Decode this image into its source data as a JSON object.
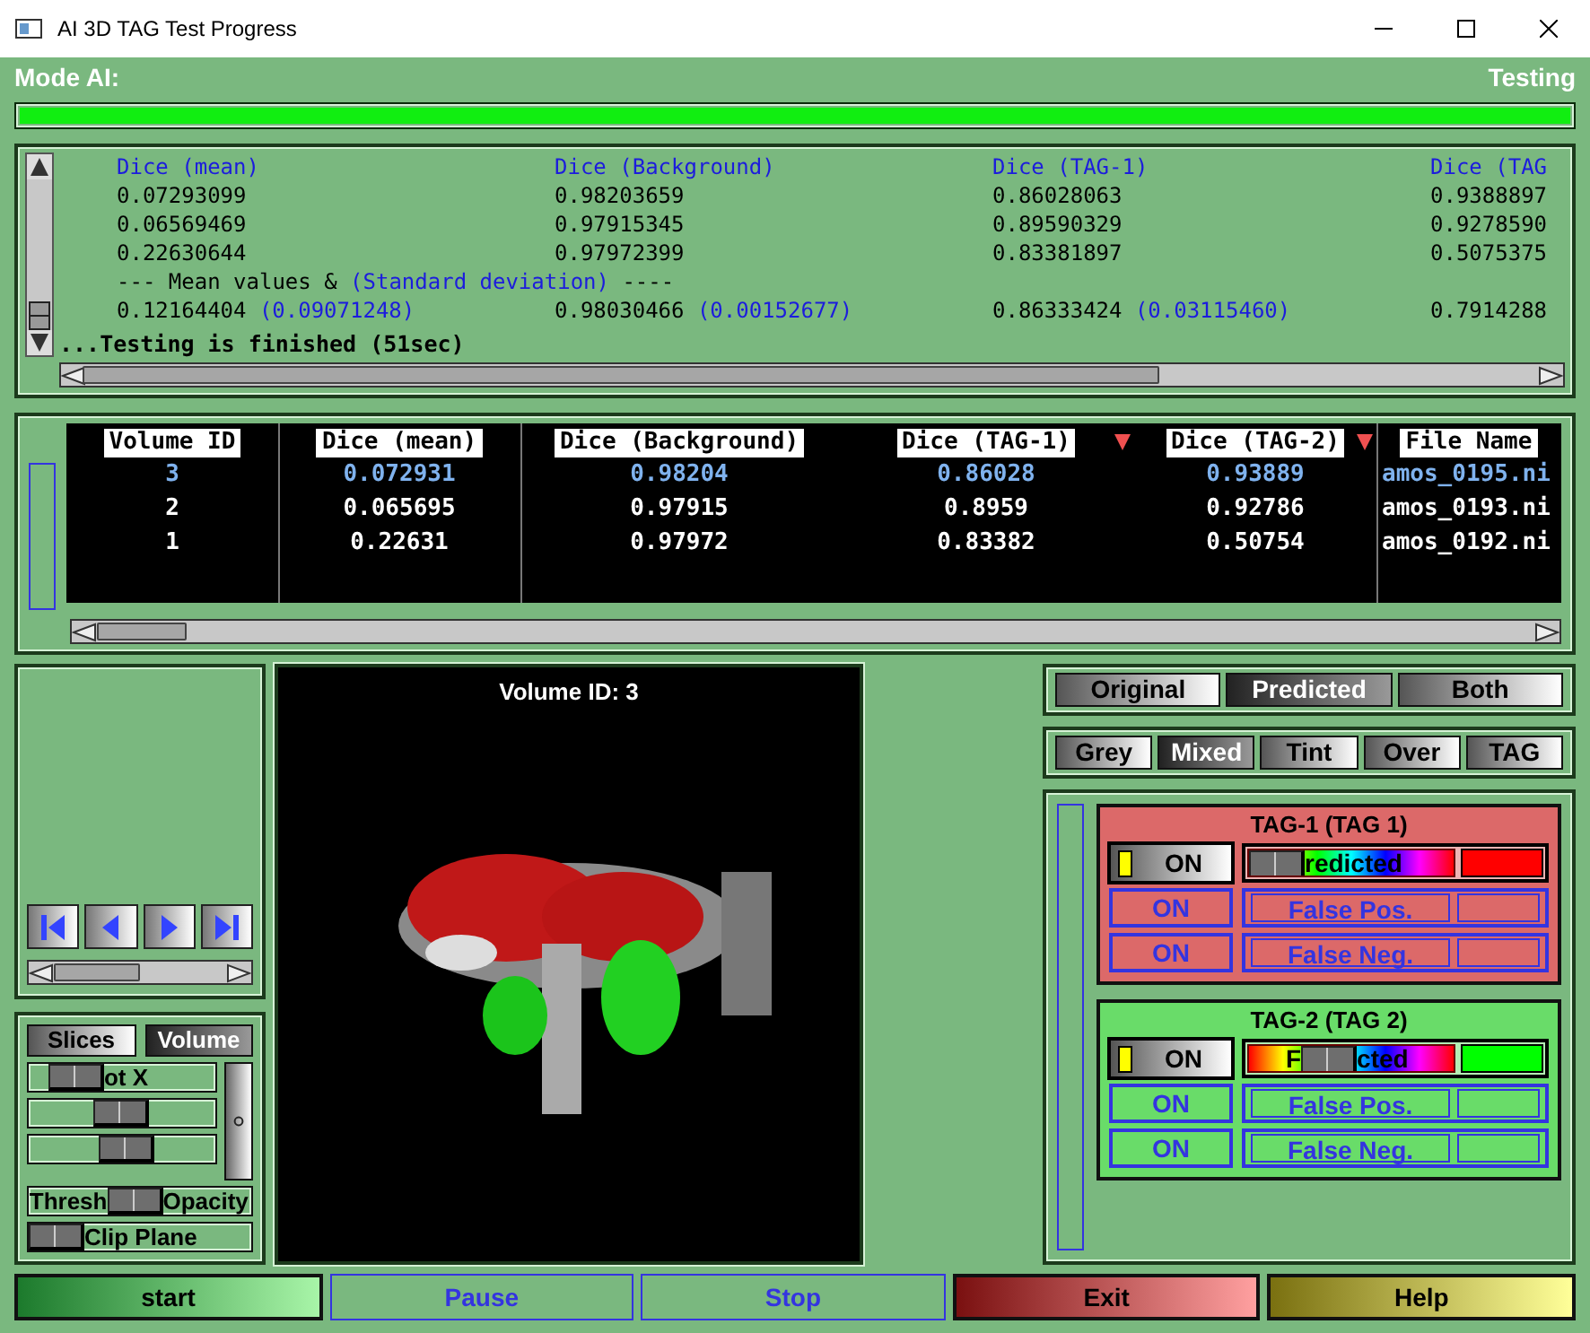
{
  "window": {
    "title": "AI 3D TAG Test Progress"
  },
  "header": {
    "mode": "Mode AI:",
    "status": "Testing"
  },
  "progress": {
    "level": 1
  },
  "log": {
    "columns": [
      "Dice (mean)",
      "Dice (Background)",
      "Dice (TAG-1)",
      "Dice (TAG"
    ],
    "rows": [
      [
        "0.07293099",
        "0.98203659",
        "0.86028063",
        "0.9388897"
      ],
      [
        "0.06569469",
        "0.97915345",
        "0.89590329",
        "0.9278590"
      ],
      [
        "0.22630644",
        "0.97972399",
        "0.83381897",
        "0.5075375"
      ]
    ],
    "summary": {
      "prefix": "--- Mean values &",
      "highlight": "(Standard deviation)",
      "suffix": "----"
    },
    "means": [
      {
        "value": "0.12164404",
        "std": "(0.09071248)"
      },
      {
        "value": "0.98030466",
        "std": "(0.00152677)"
      },
      {
        "value": "0.86333424",
        "std": "(0.03115460)"
      },
      {
        "value": "0.7914288"
      }
    ],
    "footer": "...Testing is finished (51sec)"
  },
  "table": {
    "columns": [
      {
        "label": "Volume ID"
      },
      {
        "label": "Dice (mean)"
      },
      {
        "label": "Dice (Background)"
      },
      {
        "label": "Dice (TAG-1)",
        "sorted": true
      },
      {
        "label": "Dice (TAG-2)",
        "sorted": true
      },
      {
        "label": "File Name"
      }
    ],
    "rows": [
      {
        "selected": true,
        "cells": [
          "3",
          "0.072931",
          "0.98204",
          "0.86028",
          "0.93889",
          "amos_0195.ni"
        ]
      },
      {
        "selected": false,
        "cells": [
          "2",
          "0.065695",
          "0.97915",
          "0.8959",
          "0.92786",
          "amos_0193.ni"
        ]
      },
      {
        "selected": false,
        "cells": [
          "1",
          "0.22631",
          "0.97972",
          "0.83382",
          "0.50754",
          "amos_0192.ni"
        ]
      }
    ]
  },
  "render_modes": [
    {
      "label": "Slices",
      "selected": false
    },
    {
      "label": "Volume",
      "selected": true
    }
  ],
  "sliders": [
    {
      "after": "ot X",
      "level": 0.15
    },
    {
      "level": 0.49
    },
    {
      "level": 0.54
    },
    {
      "before": "Thresh",
      "after": "Opacity",
      "level": 0.47
    },
    {
      "after": "Clip Plane",
      "level": 0
    }
  ],
  "vertical_slider": {
    "level": 0.5
  },
  "viewer": {
    "title": "Volume ID: 3"
  },
  "view_tabs": [
    {
      "label": "Original",
      "selected": false
    },
    {
      "label": "Predicted",
      "selected": true
    },
    {
      "label": "Both",
      "selected": false
    }
  ],
  "display_tabs": [
    {
      "label": "Grey",
      "selected": false
    },
    {
      "label": "Mixed",
      "selected": true
    },
    {
      "label": "Tint",
      "selected": false
    },
    {
      "label": "Over",
      "selected": false
    },
    {
      "label": "TAG",
      "selected": false
    }
  ],
  "tags": [
    {
      "title": "TAG-1 (TAG 1)",
      "color": "#ff0000",
      "toggle": {
        "label": "ON",
        "on": true
      },
      "slider": {
        "after": "redicted",
        "level": 0
      },
      "rows": [
        {
          "toggle": "ON",
          "label": "False Pos.",
          "disabled": true
        },
        {
          "toggle": "ON",
          "label": "False Neg.",
          "disabled": true
        }
      ]
    },
    {
      "title": "TAG-2 (TAG 2)",
      "color": "#00ff00",
      "toggle": {
        "label": "ON",
        "on": true
      },
      "slider": {
        "before": "F",
        "after": "cted",
        "level": 0.35
      },
      "rows": [
        {
          "toggle": "ON",
          "label": "False Pos.",
          "disabled": true
        },
        {
          "toggle": "ON",
          "label": "False Neg.",
          "disabled": true
        }
      ]
    }
  ],
  "buttons": [
    {
      "label": "start",
      "kind": "start",
      "disabled": false
    },
    {
      "label": "Pause",
      "kind": "plain",
      "disabled": true
    },
    {
      "label": "Stop",
      "kind": "plain",
      "disabled": true
    },
    {
      "label": "Exit",
      "kind": "exit",
      "disabled": false
    },
    {
      "label": "Help",
      "kind": "help",
      "disabled": false
    }
  ]
}
